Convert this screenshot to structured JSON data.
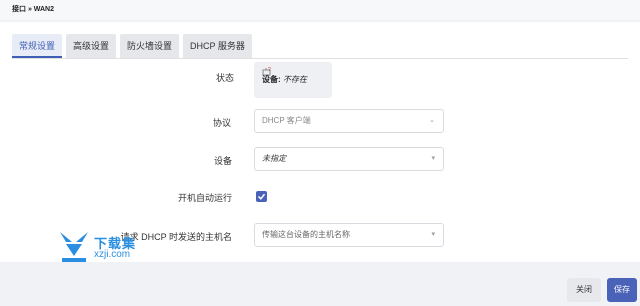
{
  "header": {
    "breadcrumb": "接口 » WAN2"
  },
  "tabs": [
    {
      "label": "常规设置",
      "active": true
    },
    {
      "label": "高级设置",
      "active": false
    },
    {
      "label": "防火墙设置",
      "active": false
    },
    {
      "label": "DHCP 服务器",
      "active": false
    }
  ],
  "form": {
    "status": {
      "label": "状态",
      "device_key": "设备:",
      "device_value": "不存在"
    },
    "protocol": {
      "label": "协议",
      "value": "DHCP 客户端"
    },
    "device": {
      "label": "设备",
      "value": "未指定"
    },
    "autostart": {
      "label": "开机自动运行",
      "checked": true
    },
    "hostname": {
      "label": "请求 DHCP 时发送的主机名",
      "placeholder": "传输这台设备的主机名称"
    }
  },
  "footer": {
    "close_label": "关闭",
    "save_label": "保存"
  },
  "watermark": {
    "line1": "下载集",
    "line2": "xzji.com"
  },
  "colors": {
    "accent": "#4a63b8",
    "watermark": "#2a8fe0"
  }
}
